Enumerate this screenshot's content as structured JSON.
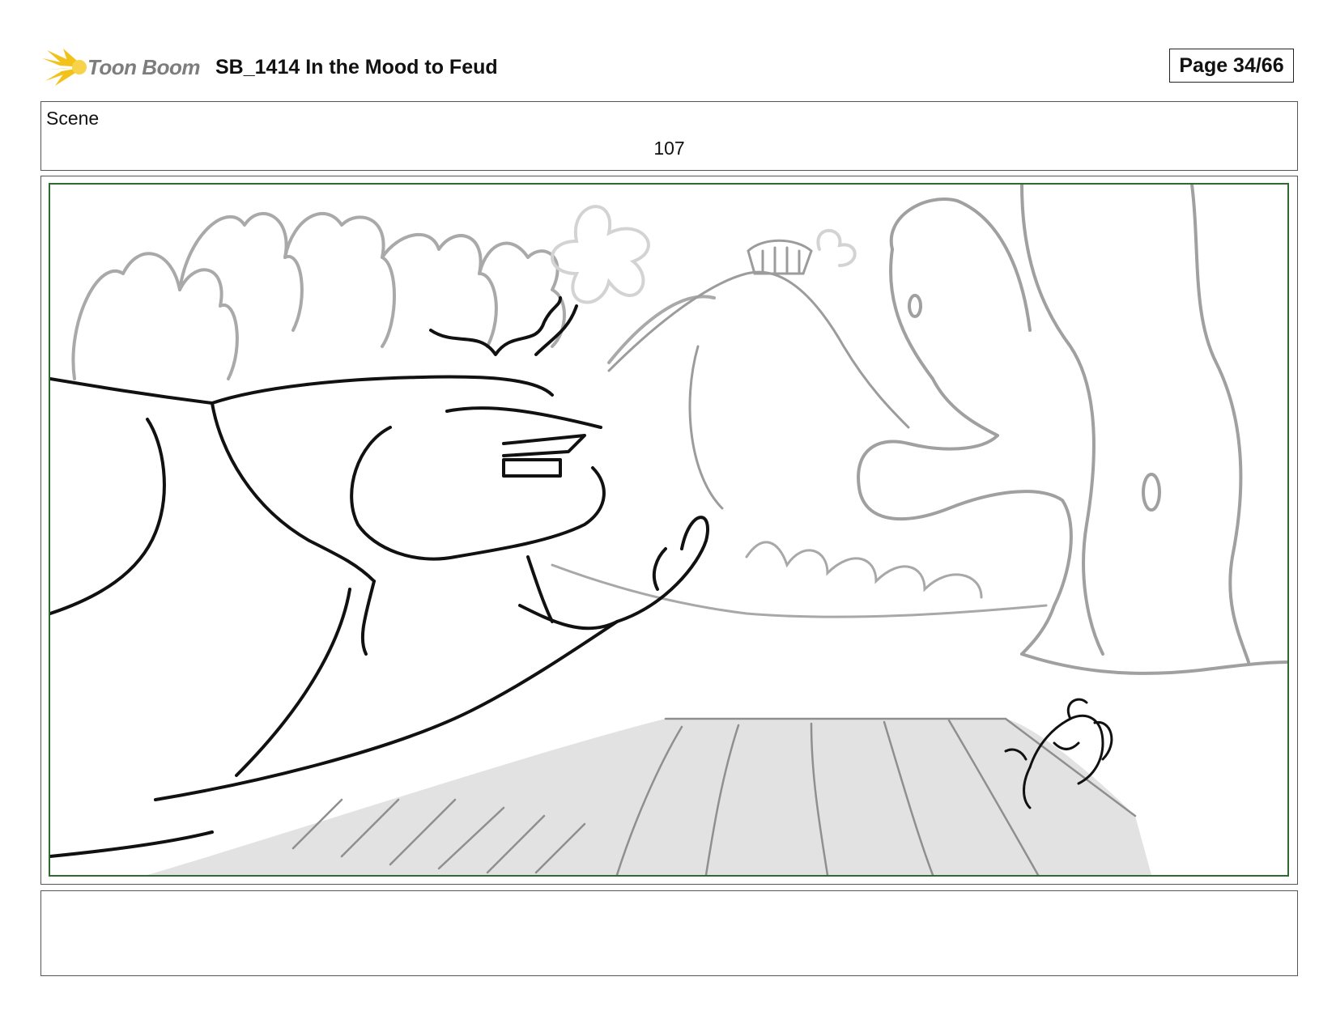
{
  "header": {
    "logo_text": "Toon Boom",
    "title": "SB_1414  In the Mood to Feud",
    "page": "Page 34/66"
  },
  "scene": {
    "label": "Scene",
    "number": "107"
  },
  "panel": {
    "image_icon": "storyboard-sketch",
    "safe_area_color": "#2f6b2f"
  },
  "notes": {
    "text": ""
  },
  "colors": {
    "logo_burst": "#f2c21b",
    "logo_text": "#7d7d7d"
  }
}
